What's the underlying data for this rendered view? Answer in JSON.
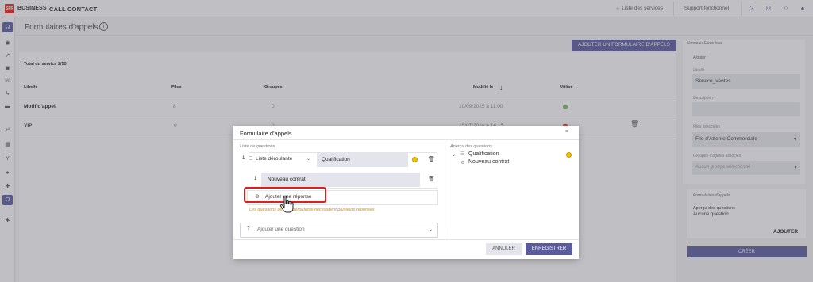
{
  "topbar": {
    "logo_text": "SFR",
    "brand": "BUSINESS",
    "app_name": "CALL CONTACT",
    "back_link": "← Liste des services",
    "support": "Support fonctionnel",
    "icons": [
      "help-icon",
      "users-icon",
      "apps-grid-icon",
      "account-icon"
    ]
  },
  "rail": {
    "icons": [
      "headset-icon",
      "eye-icon",
      "trend-icon",
      "save-icon",
      "phone-forward-icon",
      "flow-icon",
      "folder-icon",
      "swap-icon",
      "calendar-icon",
      "branch-icon",
      "record-icon",
      "user-add-icon",
      "headset-active-icon",
      "settings-icon"
    ]
  },
  "page": {
    "title": "Formulaires d'appels",
    "info_icon": "i"
  },
  "main": {
    "add_button": "AJOUTER UN FORMULAIRE D'APPELS",
    "total": "Total du service 2/50",
    "columns": [
      "Libellé",
      "Files",
      "Groupes",
      "Modifié le",
      "Utilisé"
    ],
    "sort_icon": "↓",
    "rows": [
      {
        "name": "Motif d'appel",
        "files": "8",
        "groupes": "0",
        "date": "10/09/2025 à 11:00",
        "status": "#79c05a"
      },
      {
        "name": "VIP",
        "files": "0",
        "groupes": "0",
        "date": "15/07/2024 à 14:15",
        "status": "#e24a3b"
      }
    ]
  },
  "right_panel": {
    "heading": "Nouveau Formulaire",
    "section": "Ajouter",
    "libelle_label": "Libellé",
    "libelle_value": "Service_ventes",
    "description_label": "Description",
    "files_label": "Files associées",
    "files_value": "File d'Attente Commerciale",
    "groups_label": "Groupes d'agents associés",
    "groups_placeholder": "Aucun groupe sélectionné",
    "forms_heading": "Formulaires d'appels",
    "preview_label": "Aperçu des questions",
    "preview_value": "Aucune question",
    "add_button": "AJOUTER",
    "create_button": "CRÉER"
  },
  "modal": {
    "title": "Formulaire d'appels",
    "close": "×",
    "questions_label": "Liste de questions",
    "question_number": "1",
    "question_type": "Liste déroulante",
    "question_value": "Qualification",
    "response_number": "1",
    "response_value": "Nouveau contrat",
    "add_response": "Ajouter une réponse",
    "warning": "Les questions de liste déroulante nécessitent plusieurs réponses",
    "add_question": "Ajouter une question",
    "preview_label": "Aperçu des questions",
    "preview_question": "Qualification",
    "preview_response": "Nouveau contrat",
    "cancel": "ANNULER",
    "save": "ENREGISTRER"
  }
}
